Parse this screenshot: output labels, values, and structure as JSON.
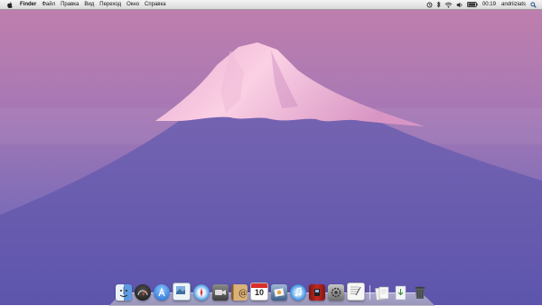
{
  "menubar": {
    "apple_icon": "apple-icon",
    "app_name": "Finder",
    "menus": [
      "Файл",
      "Правка",
      "Вид",
      "Переход",
      "Окно",
      "Справка"
    ],
    "status": {
      "icons": [
        "time-machine-icon",
        "bluetooth-icon",
        "wifi-icon",
        "volume-icon",
        "battery-icon"
      ],
      "clock": "00:19",
      "user": "andriiziats"
    },
    "spotlight_icon": "spotlight-icon"
  },
  "wallpaper": {
    "subject": "Mount Fuji",
    "colors": {
      "sky_top": "#b97dae",
      "sky_mid": "#8e73b8",
      "mountain": "#6c5cb0",
      "snow": "#f2b8d6"
    }
  },
  "dock": {
    "apps": [
      {
        "name": "finder-icon",
        "color": "#6aa7e6"
      },
      {
        "name": "dashboard-icon",
        "color": "#2b2b2b"
      },
      {
        "name": "app-store-icon",
        "color": "#2a7ad6"
      },
      {
        "name": "preview-icon",
        "color": "#8bb4d8"
      },
      {
        "name": "safari-icon",
        "color": "#3b8fdc"
      },
      {
        "name": "facetime-icon",
        "color": "#5a5a5a"
      },
      {
        "name": "address-book-icon",
        "color": "#c9a46a"
      },
      {
        "name": "ical-icon",
        "color": "#ffffff"
      },
      {
        "name": "iphoto-icon",
        "color": "#4f6f9a"
      },
      {
        "name": "itunes-icon",
        "color": "#3a8ad9"
      },
      {
        "name": "photo-booth-icon",
        "color": "#b0221e"
      },
      {
        "name": "system-preferences-icon",
        "color": "#8d8d8d"
      },
      {
        "name": "textedit-icon",
        "color": "#f1f1f1"
      }
    ],
    "stacks": [
      {
        "name": "documents-stack-icon",
        "color": "#e9e9ef"
      },
      {
        "name": "downloads-stack-icon",
        "color": "#dfe6ee"
      },
      {
        "name": "trash-icon",
        "color": "#50545a"
      }
    ]
  }
}
